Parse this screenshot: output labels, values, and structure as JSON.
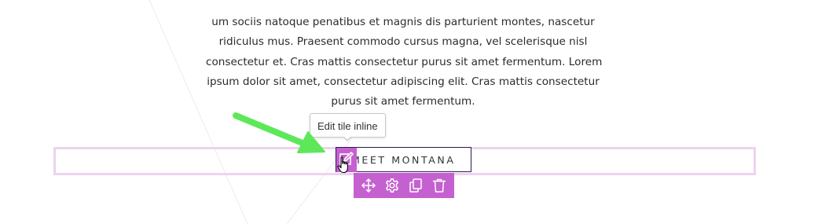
{
  "paragraph": {
    "lines": [
      "um sociis natoque penatibus et magnis dis parturient montes, nascetur",
      "ridiculus mus. Praesent commodo cursus magna, vel scelerisque nisl",
      "consectetur et. Cras mattis consectetur purus sit amet fermentum. Lorem",
      "ipsum dolor sit amet, consectetur adipiscing elit. Cras mattis consectetur",
      "purus sit amet fermentum."
    ]
  },
  "tile": {
    "title": "MEET MONTANA"
  },
  "tooltip": {
    "text": "Edit tile inline"
  },
  "toolbar": {
    "buttons": [
      {
        "icon": "move-icon"
      },
      {
        "icon": "gear-icon"
      },
      {
        "icon": "duplicate-icon"
      },
      {
        "icon": "trash-icon"
      }
    ]
  },
  "colors": {
    "accent": "#c560d0",
    "row_outline": "#ecd3ee",
    "tile_border": "#2b1a4a",
    "annotation_arrow": "#5de85a"
  }
}
